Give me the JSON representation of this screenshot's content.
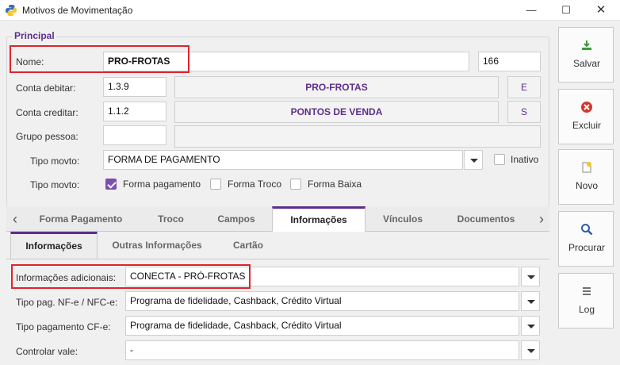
{
  "window": {
    "title": "Motivos de Movimentação",
    "minimize": "—",
    "maximize": "☐",
    "close": "✕"
  },
  "principal": {
    "group_title": "Principal",
    "nome": {
      "label": "Nome:",
      "value": "PRO-FROTAS",
      "code": "166"
    },
    "conta_debitar": {
      "label": "Conta debitar:",
      "value": "1.3.9",
      "description": "PRO-FROTAS",
      "tag": "E"
    },
    "conta_creditar": {
      "label": "Conta creditar:",
      "value": "1.1.2",
      "description": "PONTOS DE VENDA",
      "tag": "S"
    },
    "grupo_pessoa": {
      "label": "Grupo pessoa:",
      "value": "",
      "description": ""
    },
    "tipo_movto_select": {
      "label": "Tipo movto:",
      "value": "FORMA DE PAGAMENTO"
    },
    "inativo": {
      "label": "Inativo",
      "checked": false
    },
    "tipo_movto_checks": {
      "label": "Tipo movto:",
      "options": [
        {
          "label": "Forma pagamento",
          "checked": true
        },
        {
          "label": "Forma Troco",
          "checked": false
        },
        {
          "label": "Forma Baixa",
          "checked": false
        }
      ]
    }
  },
  "tabs": [
    "Forma Pagamento",
    "Troco",
    "Campos",
    "Informações",
    "Vínculos",
    "Documentos"
  ],
  "active_tab": "Informações",
  "subtabs": [
    "Informações",
    "Outras Informações",
    "Cartão"
  ],
  "active_subtab": "Informações",
  "info_fields": [
    {
      "label": "Informações adicionais:",
      "value": "CONECTA - PRÓ-FROTAS"
    },
    {
      "label": "Tipo pag. NF-e / NFC-e:",
      "value": "Programa de fidelidade, Cashback, Crédito Virtual"
    },
    {
      "label": "Tipo pagamento CF-e:",
      "value": "Programa de fidelidade, Cashback, Crédito Virtual"
    },
    {
      "label": "Controlar vale:",
      "value": "-"
    }
  ],
  "sidebar": {
    "buttons": [
      {
        "label": "Salvar",
        "icon": "save-icon"
      },
      {
        "label": "Excluir",
        "icon": "delete-icon"
      },
      {
        "label": "Novo",
        "icon": "new-document-icon"
      },
      {
        "label": "Procurar",
        "icon": "search-icon"
      },
      {
        "label": "Log",
        "icon": "log-icon"
      }
    ]
  },
  "colors": {
    "accent": "#5d2e8c",
    "highlight": "#e0232b",
    "checkbox": "#7b4fb0"
  }
}
